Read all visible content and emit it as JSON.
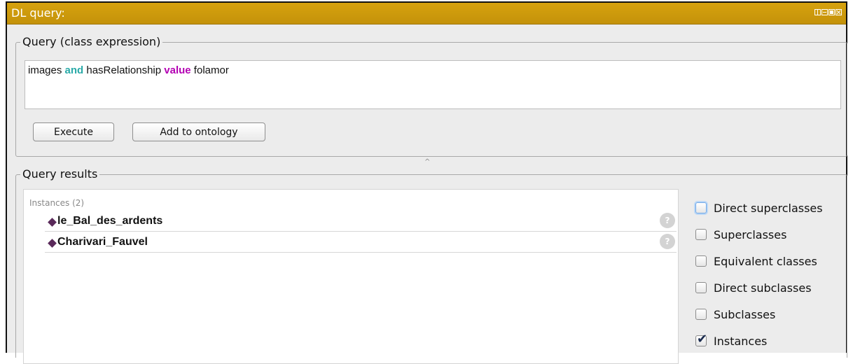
{
  "window": {
    "title": "DL query:"
  },
  "query": {
    "group_label": "Query (class expression)",
    "expression": [
      {
        "text": "images ",
        "style": "plain"
      },
      {
        "text": "and",
        "style": "keyword-and"
      },
      {
        "text": " hasRelationship ",
        "style": "plain"
      },
      {
        "text": "value",
        "style": "keyword-value"
      },
      {
        "text": " folamor",
        "style": "plain"
      }
    ],
    "execute_label": "Execute",
    "add_label": "Add to ontology"
  },
  "results": {
    "group_label": "Query results",
    "header": "Instances (2)",
    "items": [
      {
        "label": "le_Bal_des_ardents",
        "help": "?"
      },
      {
        "label": "Charivari_Fauvel",
        "help": "?"
      }
    ]
  },
  "options": [
    {
      "label": "Direct superclasses",
      "checked": false,
      "focused": true
    },
    {
      "label": "Superclasses",
      "checked": false
    },
    {
      "label": "Equivalent classes",
      "checked": false
    },
    {
      "label": "Direct subclasses",
      "checked": false
    },
    {
      "label": "Subclasses",
      "checked": false
    },
    {
      "label": "Instances",
      "checked": true
    }
  ],
  "colors": {
    "title_bar": "#c9970c",
    "keyword_and": "#2aaaa8",
    "keyword_value": "#b300b3",
    "instance_diamond": "#5a2a5a"
  }
}
